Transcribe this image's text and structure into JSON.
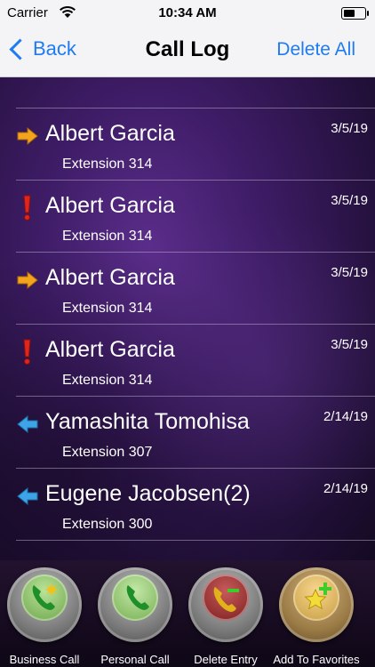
{
  "status_bar": {
    "carrier": "Carrier",
    "time": "10:34 AM"
  },
  "nav": {
    "back_label": "Back",
    "title": "Call Log",
    "delete_all_label": "Delete All"
  },
  "calls": [
    {
      "icon": "outgoing-arrow-icon",
      "name": "Albert Garcia",
      "extension": "Extension 314",
      "date": "3/5/19"
    },
    {
      "icon": "missed-exclamation-icon",
      "name": "Albert Garcia",
      "extension": "Extension 314",
      "date": "3/5/19"
    },
    {
      "icon": "outgoing-arrow-icon",
      "name": "Albert Garcia",
      "extension": "Extension 314",
      "date": "3/5/19"
    },
    {
      "icon": "missed-exclamation-icon",
      "name": "Albert Garcia",
      "extension": "Extension 314",
      "date": "3/5/19"
    },
    {
      "icon": "incoming-arrow-icon",
      "name": "Yamashita Tomohisa",
      "extension": "Extension 307",
      "date": "2/14/19"
    },
    {
      "icon": "incoming-arrow-icon",
      "name": "Eugene Jacobsen(2)",
      "extension": "Extension 300",
      "date": "2/14/19"
    }
  ],
  "toolbar": {
    "business_call": "Business Call",
    "personal_call": "Personal Call",
    "delete_entry": "Delete Entry",
    "add_to_favorites": "Add To Favorites"
  },
  "colors": {
    "accent": "#1e7bf2",
    "outgoing": "#f2a41c",
    "missed": "#e0251d",
    "incoming": "#3ea4e8"
  }
}
